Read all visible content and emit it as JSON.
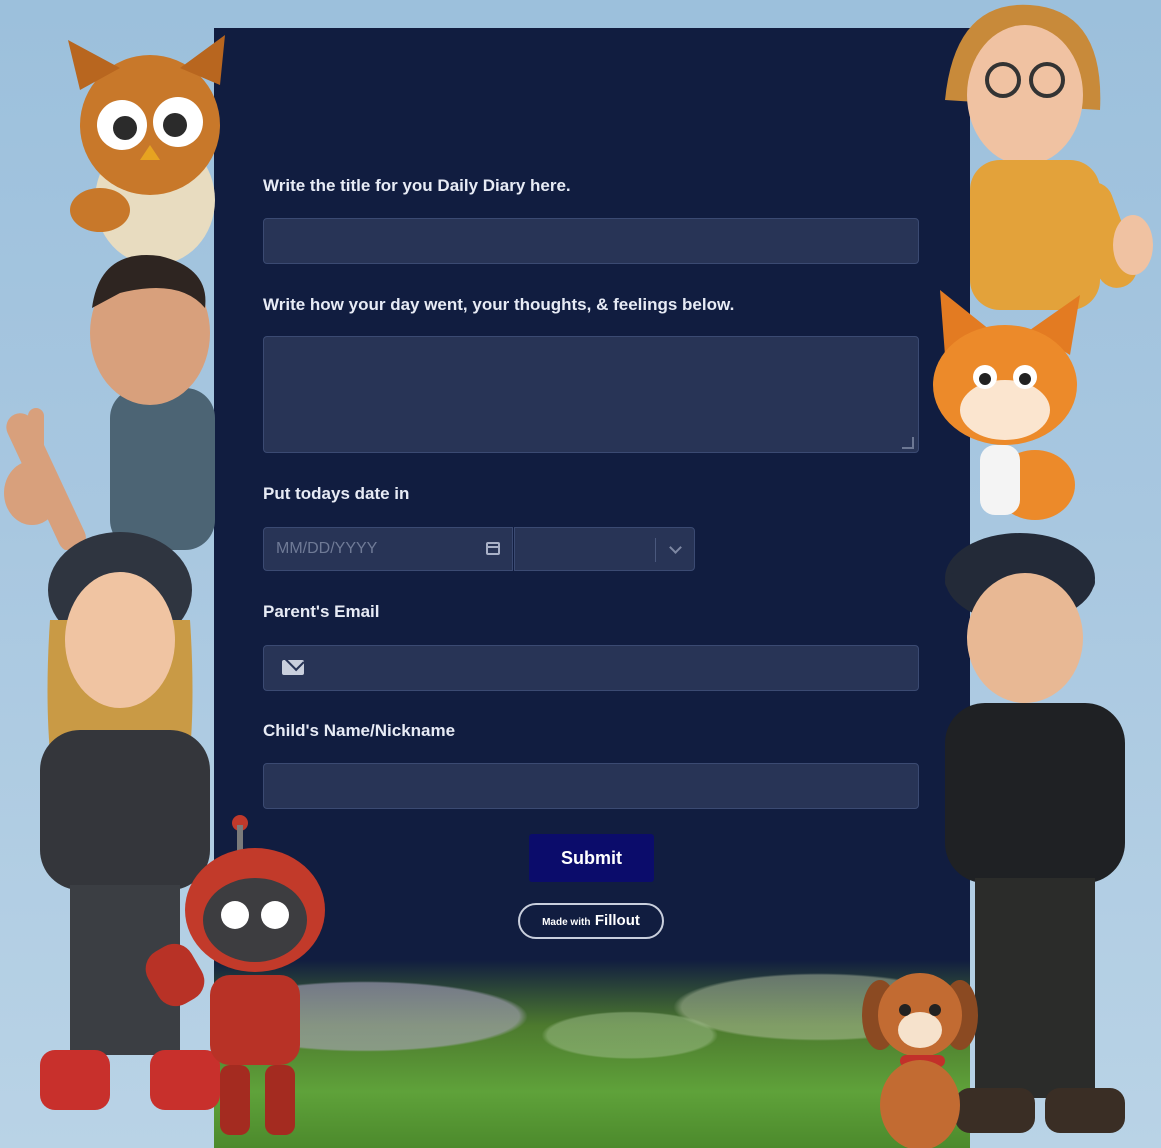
{
  "form": {
    "title_label": "Write the title for you Daily Diary here.",
    "diary_label": "Write how your day went, your thoughts, & feelings below.",
    "date_label": "Put todays date in",
    "date_placeholder": "MM/DD/YYYY",
    "email_label": "Parent's Email",
    "name_label": "Child's Name/Nickname",
    "submit_label": "Submit"
  },
  "footer": {
    "made_with": "Made with",
    "brand": "Fillout"
  },
  "icons": [
    "calendar-icon",
    "chevron-down-icon",
    "mail-icon"
  ],
  "colors": {
    "panel": "#111d40",
    "field": "#283456",
    "submit": "#0b0c6b",
    "background": "#a8c7e0"
  }
}
